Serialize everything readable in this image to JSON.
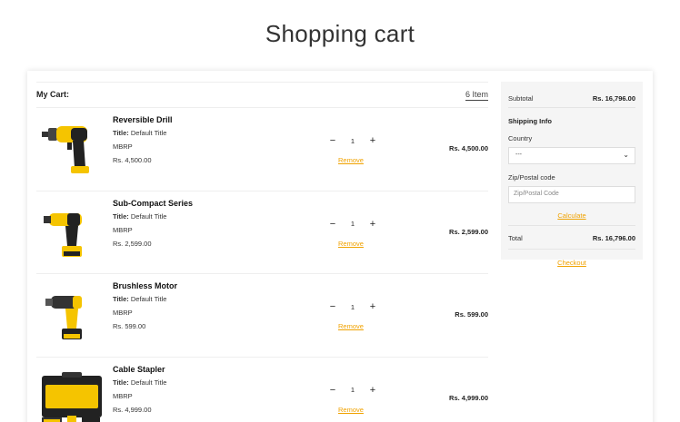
{
  "page": {
    "title": "Shopping cart"
  },
  "cart": {
    "label": "My Cart:",
    "count": "6 Item",
    "items": [
      {
        "name": "Reversible Drill",
        "title_label": "Title:",
        "title_value": "Default Title",
        "mbrp": "MBRP",
        "unit_price": "Rs. 4,500.00",
        "qty": "1",
        "remove": "Remove",
        "total": "Rs. 4,500.00"
      },
      {
        "name": "Sub-Compact Series",
        "title_label": "Title:",
        "title_value": "Default Title",
        "mbrp": "MBRP",
        "unit_price": "Rs. 2,599.00",
        "qty": "1",
        "remove": "Remove",
        "total": "Rs. 2,599.00"
      },
      {
        "name": "Brushless Motor",
        "title_label": "Title:",
        "title_value": "Default Title",
        "mbrp": "MBRP",
        "unit_price": "Rs. 599.00",
        "qty": "1",
        "remove": "Remove",
        "total": "Rs. 599.00"
      },
      {
        "name": "Cable Stapler",
        "title_label": "Title:",
        "title_value": "Default Title",
        "mbrp": "MBRP",
        "unit_price": "Rs. 4,999.00",
        "qty": "1",
        "remove": "Remove",
        "total": "Rs. 4,999.00"
      }
    ],
    "minus": "−",
    "plus": "+"
  },
  "summary": {
    "subtotal_label": "Subtotal",
    "subtotal_value": "Rs. 16,796.00",
    "shipping_title": "Shipping Info",
    "country_label": "Country",
    "country_value": "---",
    "zip_label": "Zip/Postal code",
    "zip_placeholder": "Zip/Postal Code",
    "calculate": "Calculate",
    "total_label": "Total",
    "total_value": "Rs. 16,796.00",
    "checkout": "Checkout"
  },
  "colors": {
    "accent": "#f0a200",
    "tool_yellow": "#f5c400",
    "tool_black": "#222222"
  },
  "icons": {
    "select_caret": "chevron-down-icon"
  }
}
